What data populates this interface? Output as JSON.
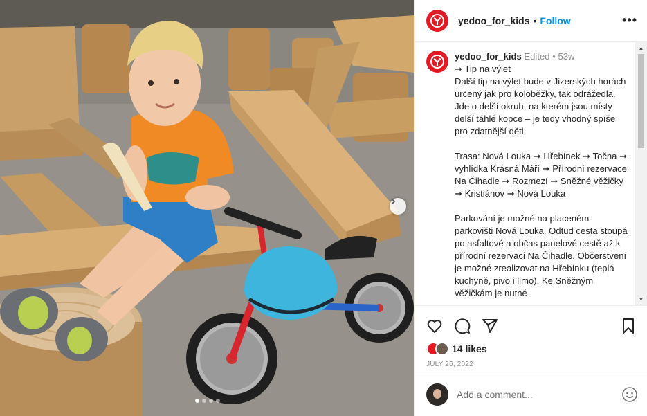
{
  "post": {
    "username": "yedoo_for_kids",
    "follow_label": "Follow",
    "separator": "•",
    "edited_label": "Edited",
    "age": "53w",
    "caption": "➞ Tip na výlet\nDalší tip na výlet bude v Jizerských horách určený jak pro koloběžky, tak odrážedla. Jde o delší okruh, na kterém jsou místy delší táhlé kopce – je tedy vhodný spíše pro zdatnější děti.\n\nTrasa: Nová Louka ➞ Hřebínek ➞ Točna ➞ vyhlídka Krásná Máří ➞ Přírodní rezervace Na Čihadle ➞ Rozmezí ➞ Sněžné věžičky ➞ Kristiánov ➞ Nová Louka\n\nParkování je možné na placeném parkovišti Nová Louka. Odtud cesta stoupá po asfaltové a občas panelové cestě až k přírodní rezervaci Na Čihadle. Občerstvení je možné zrealizovat na Hřebínku (teplá kuchyně, pivo i limo). Ke Sněžným věžičkám je nutné",
    "likes": "14 likes",
    "date": "JULY 26, 2022",
    "comment_placeholder": "Add a comment..."
  },
  "carousel": {
    "slide_count": 4,
    "active_index": 0
  },
  "icons": {
    "more": "more-options-icon",
    "like": "heart-icon",
    "comment": "comment-icon",
    "share": "share-icon",
    "save": "bookmark-icon",
    "emoji": "emoji-icon",
    "next": "chevron-right-icon"
  },
  "colors": {
    "brand": "#e21a23",
    "follow": "#0095f6",
    "text": "#262626",
    "muted": "#8e8e8e"
  }
}
